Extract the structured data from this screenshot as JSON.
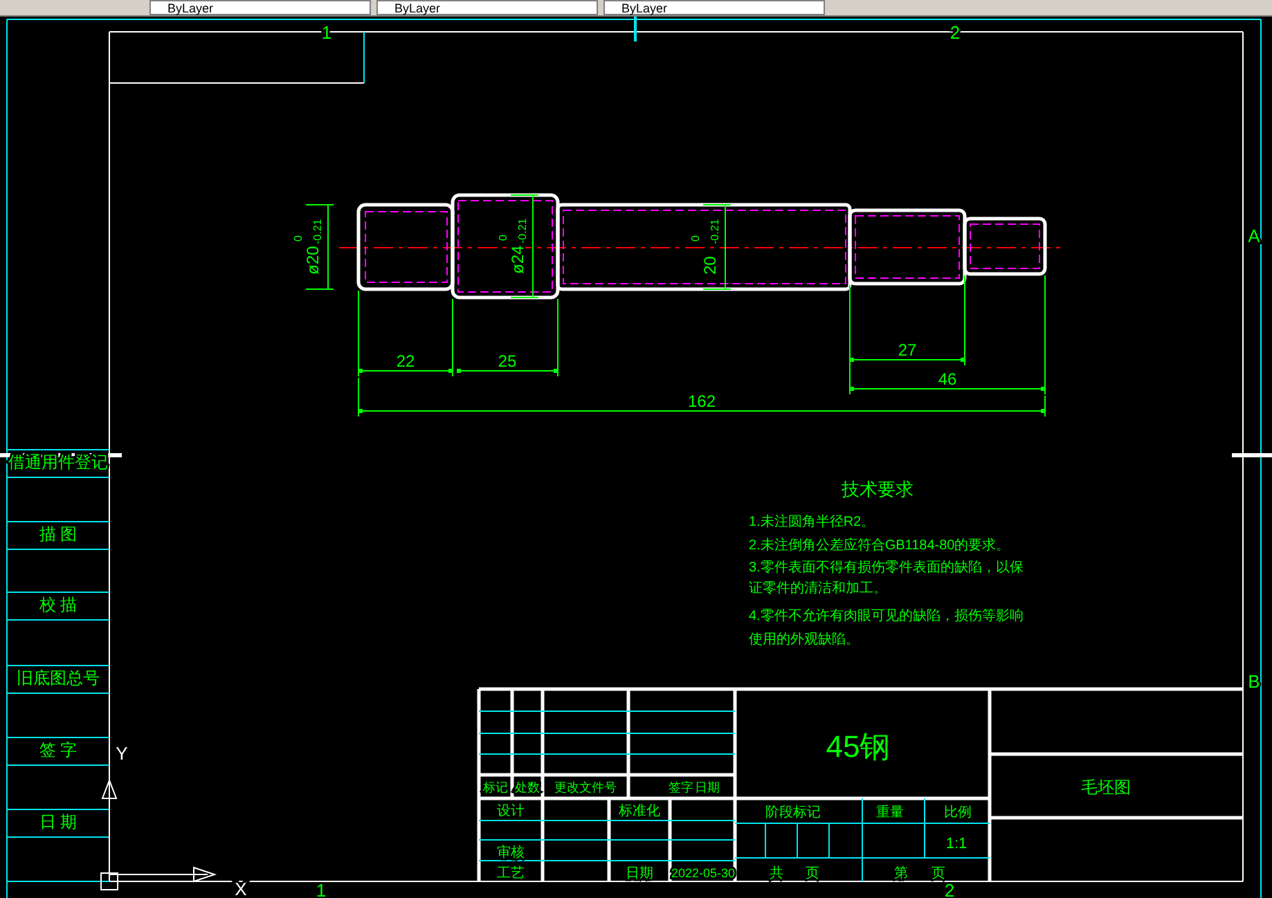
{
  "toolbar": {
    "dropdowns": [
      {
        "value": "ByLayer"
      },
      {
        "value": "ByLayer"
      },
      {
        "value": "ByLayer"
      }
    ]
  },
  "drawing": {
    "zone_marks": [
      "1",
      "2",
      "A",
      "B",
      "1",
      "2"
    ],
    "shaft_diameters": [
      {
        "value": "ø20",
        "upper": "0",
        "lower": "-0.21"
      },
      {
        "value": "ø24",
        "upper": "0",
        "lower": "-0.21"
      },
      {
        "value": "20",
        "upper": "0",
        "lower": "-0.21"
      }
    ],
    "lengths": [
      "22",
      "25",
      "27",
      "46",
      "162"
    ],
    "left_strip": [
      "借通用件登记",
      "描 图",
      "校 描",
      "旧底图总号",
      "签 字",
      "日 期"
    ],
    "technical_requirements": {
      "title": "技术要求",
      "lines": [
        "1.未注圆角半径R2。",
        "2.未注倒角公差应符合GB1184-80的要求。",
        "3.零件表面不得有损伤零件表面的缺陷，以保",
        "证零件的清洁和加工。",
        "4.零件不允许有肉眼可见的缺陷，损伤等影响",
        "使用的外观缺陷。"
      ]
    },
    "title_block": {
      "change_headers": [
        "标记",
        "处数",
        "更改文件号",
        "签字",
        "日期"
      ],
      "designer_label": "设计",
      "standardization_label": "标准化",
      "review_label": "审核",
      "process_label": "工艺",
      "date_label": "日期",
      "date": "2022-05-30",
      "material": "45钢",
      "stage_label": "阶段标记",
      "weight_label": "重量",
      "scale_label": "比例",
      "scale": "1:1",
      "total_label": "共",
      "total_page_label": "页",
      "sheet_label": "第",
      "sheet_page_label": "页",
      "drawing_title": "毛坯图"
    },
    "ucs": {
      "y_label": "Y",
      "x_label": "X"
    }
  }
}
